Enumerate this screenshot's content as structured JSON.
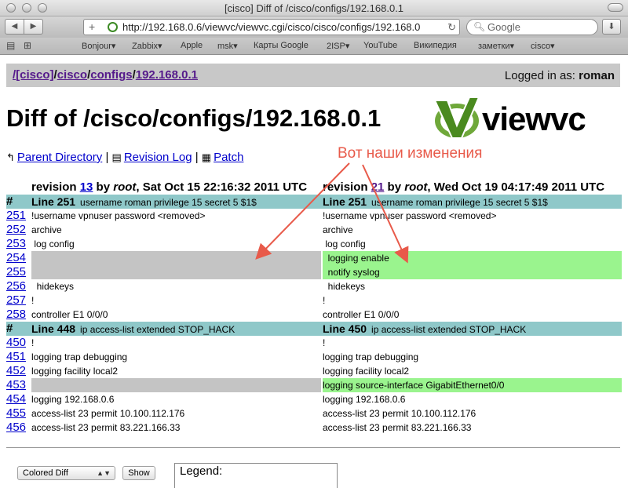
{
  "window": {
    "title": "[cisco] Diff of /cisco/configs/192.168.0.1"
  },
  "toolbar": {
    "back_label": "◀",
    "forward_label": "▶",
    "add_label": "+",
    "url": "http://192.168.0.6/viewvc/viewvc.cgi/cisco/cisco/configs/192.168.0",
    "reload_label": "↻",
    "search_placeholder": "Google",
    "download_label": "⬇"
  },
  "bookmarks": [
    "Bonjour▾",
    "Zabbix▾",
    "Apple",
    "msk▾",
    "Карты Google",
    "2ISP▾",
    "YouTube",
    "Википедия",
    "заметки▾",
    "cisco▾"
  ],
  "breadcrumb": {
    "sep0": "/",
    "root": "[cisco]",
    "sep1": "/",
    "dir1": "cisco",
    "sep2": "/",
    "dir2": "configs",
    "sep3": "/",
    "file": "192.168.0.1",
    "login_prefix": "Logged in as: ",
    "login_user": "roman"
  },
  "page": {
    "title": "Diff of /cisco/configs/192.168.0.1",
    "logo_text": "viewvc"
  },
  "nav": {
    "parent": "Parent Directory",
    "sep1": " | ",
    "revlog": "Revision Log",
    "sep2": " | ",
    "patch": "Patch"
  },
  "annotation": "Вот наши изменения",
  "revisions": {
    "left": {
      "prefix": "revision ",
      "rev": "13",
      "by": " by ",
      "author": "root",
      "date": ", Sat Oct 15 22:16:32 2011 UTC"
    },
    "right": {
      "prefix": "revision ",
      "rev": "21",
      "by": " by ",
      "author": "root",
      "date": ", Wed Oct 19 04:17:49 2011 UTC"
    }
  },
  "diff": {
    "hunk1": {
      "hash": "#",
      "left_line": "Line 251",
      "left_text": "username roman privilege 15 secret 5 $1$",
      "right_line": "Line 251",
      "right_text": "username roman privilege 15 secret 5 $1$"
    },
    "rows1": [
      {
        "num": "251",
        "left": "!username vpnuser password <removed>",
        "right": "!username vpnuser password <removed>"
      },
      {
        "num": "252",
        "left": "archive",
        "right": "archive"
      },
      {
        "num": "253",
        "left": " log config",
        "right": " log config"
      },
      {
        "num": "254",
        "left": "",
        "right": "  logging enable"
      },
      {
        "num": "255",
        "left": "",
        "right": "  notify syslog"
      },
      {
        "num": "256",
        "left": "  hidekeys",
        "right": "  hidekeys"
      },
      {
        "num": "257",
        "left": "!",
        "right": "!"
      },
      {
        "num": "258",
        "left": "controller E1 0/0/0",
        "right": "controller E1 0/0/0"
      }
    ],
    "hunk2": {
      "hash": "#",
      "left_line": "Line 448",
      "left_text": "ip access-list extended STOP_HACK",
      "right_line": "Line 450",
      "right_text": "ip access-list extended STOP_HACK"
    },
    "rows2": [
      {
        "num": "450",
        "left": "!",
        "right": "!"
      },
      {
        "num": "451",
        "left": "logging trap debugging",
        "right": "logging trap debugging"
      },
      {
        "num": "452",
        "left": "logging facility local2",
        "right": "logging facility local2"
      },
      {
        "num": "453",
        "left": "",
        "right": "logging source-interface GigabitEthernet0/0"
      },
      {
        "num": "454",
        "left": "logging 192.168.0.6",
        "right": "logging 192.168.0.6"
      },
      {
        "num": "455",
        "left": "access-list 23 permit 10.100.112.176",
        "right": "access-list 23 permit 10.100.112.176"
      },
      {
        "num": "456",
        "left": "access-list 23 permit 83.221.166.33",
        "right": "access-list 23 permit 83.221.166.33"
      }
    ]
  },
  "footer": {
    "diff_format": "Colored Diff",
    "show_label": "Show",
    "legend_label": "Legend:"
  },
  "colors": {
    "hunk_header": "#8fc8c9",
    "removed": "#c4c4c4",
    "added": "#9af48e",
    "annotation": "#e85a4a",
    "link": "#0000cc"
  }
}
